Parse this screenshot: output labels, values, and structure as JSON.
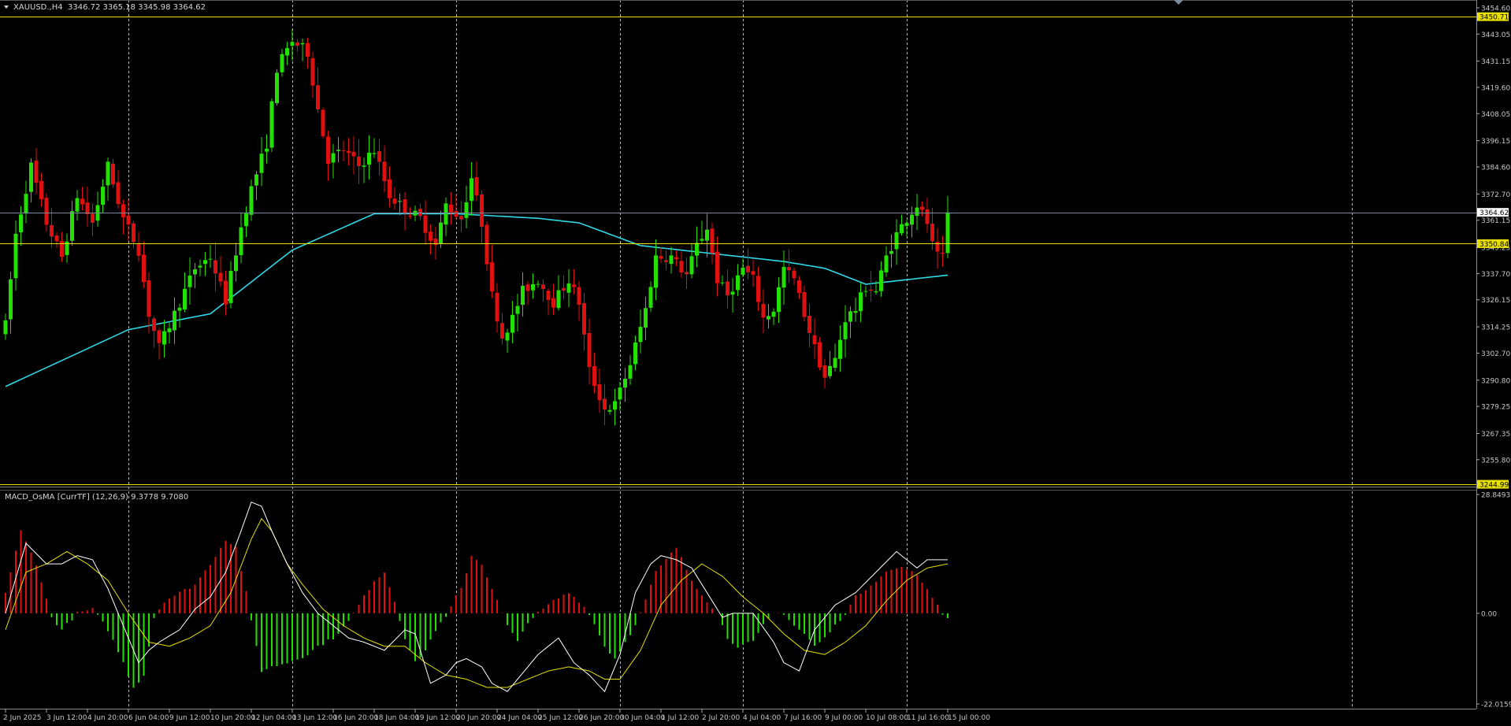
{
  "main_header": {
    "symbol": "XAUUSD.,H4",
    "open": "3346.72",
    "high": "3365.18",
    "low": "3345.98",
    "close": "3364.62"
  },
  "sub_header": {
    "indicator": "MACD_OsMA [CurrTF] (12,26,9)",
    "value1": "9.3778",
    "value2": "9.7080"
  },
  "colors": {
    "background": "#000000",
    "bull": "#22e000",
    "bear": "#e01010",
    "ma": "#30d8e8",
    "hline": "#e8e000",
    "macd_main": "#ffffff",
    "macd_signal": "#e8e000",
    "axis_text": "#c8c8c8"
  },
  "price_axis": {
    "ylim": [
      3245.0,
      3457.0
    ],
    "tick_labels": [
      "3454.60",
      "3443.05",
      "3431.15",
      "3419.60",
      "3408.05",
      "3396.15",
      "3384.60",
      "3372.70",
      "3361.15",
      "3349.25",
      "3337.70",
      "3326.15",
      "3314.25",
      "3302.70",
      "3290.80",
      "3279.25",
      "3267.35",
      "3255.80"
    ],
    "tick_values": [
      3454.6,
      3443.05,
      3431.15,
      3419.6,
      3408.05,
      3396.15,
      3384.6,
      3372.7,
      3361.15,
      3349.25,
      3337.7,
      3326.15,
      3314.25,
      3302.7,
      3290.8,
      3279.25,
      3267.35,
      3255.8
    ],
    "current_price": "3364.62",
    "hlines": [
      {
        "label": "3450.71",
        "value": 3450.71
      },
      {
        "label": "3350.84",
        "value": 3350.84
      },
      {
        "label": "3244.99",
        "value": 3244.99
      }
    ]
  },
  "macd_axis": {
    "ylim": [
      -22.0159,
      28.8493
    ],
    "tick_labels": [
      "28.8493",
      "0.00",
      "-22.0159"
    ],
    "tick_values": [
      28.8493,
      0.0,
      -22.0159
    ]
  },
  "time_axis": {
    "labels": [
      "2 Jun 2025",
      "3 Jun 12:00",
      "4 Jun 20:00",
      "6 Jun 04:00",
      "9 Jun 12:00",
      "10 Jun 20:00",
      "12 Jun 04:00",
      "13 Jun 12:00",
      "16 Jun 20:00",
      "18 Jun 04:00",
      "19 Jun 12:00",
      "20 Jun 20:00",
      "24 Jun 04:00",
      "25 Jun 12:00",
      "26 Jun 20:00",
      "30 Jun 04:00",
      "1 Jul 12:00",
      "2 Jul 20:00",
      "4 Jul 04:00",
      "7 Jul 16:00",
      "9 Jul 00:00",
      "10 Jul 08:00",
      "11 Jul 16:00",
      "15 Jul 00:00"
    ],
    "label_bar_index": [
      0,
      8,
      16,
      24,
      32,
      40,
      48,
      56,
      64,
      72,
      80,
      88,
      96,
      104,
      112,
      120,
      128,
      136,
      144,
      152,
      160,
      168,
      176,
      184
    ],
    "separator_labels": [
      "6 Jun 04:00",
      "13 Jun 12:00",
      "20 Jun 20:00",
      "30 Jun 04:00",
      "4 Jul 04:00",
      "11 Jul 16:00"
    ]
  },
  "chart_data": [
    {
      "type": "candlestick",
      "title": "XAUUSD.,H4",
      "anchors": [
        [
          0,
          3315
        ],
        [
          2,
          3355
        ],
        [
          5,
          3385
        ],
        [
          8,
          3360
        ],
        [
          11,
          3345
        ],
        [
          14,
          3372
        ],
        [
          17,
          3360
        ],
        [
          20,
          3385
        ],
        [
          23,
          3362
        ],
        [
          26,
          3348
        ],
        [
          28,
          3320
        ],
        [
          30,
          3305
        ],
        [
          34,
          3325
        ],
        [
          37,
          3340
        ],
        [
          40,
          3345
        ],
        [
          43,
          3326
        ],
        [
          46,
          3358
        ],
        [
          48,
          3375
        ],
        [
          51,
          3395
        ],
        [
          53,
          3428
        ],
        [
          56,
          3440
        ],
        [
          59,
          3435
        ],
        [
          61,
          3410
        ],
        [
          63,
          3388
        ],
        [
          66,
          3392
        ],
        [
          69,
          3385
        ],
        [
          72,
          3392
        ],
        [
          75,
          3372
        ],
        [
          78,
          3366
        ],
        [
          81,
          3362
        ],
        [
          84,
          3350
        ],
        [
          86,
          3368
        ],
        [
          89,
          3362
        ],
        [
          91,
          3380
        ],
        [
          93,
          3360
        ],
        [
          95,
          3328
        ],
        [
          97,
          3310
        ],
        [
          99,
          3318
        ],
        [
          101,
          3330
        ],
        [
          104,
          3335
        ],
        [
          107,
          3325
        ],
        [
          110,
          3335
        ],
        [
          112,
          3325
        ],
        [
          114,
          3295
        ],
        [
          117,
          3278
        ],
        [
          119,
          3280
        ],
        [
          122,
          3298
        ],
        [
          125,
          3322
        ],
        [
          127,
          3345
        ],
        [
          130,
          3345
        ],
        [
          133,
          3337
        ],
        [
          135,
          3350
        ],
        [
          137,
          3358
        ],
        [
          139,
          3335
        ],
        [
          141,
          3328
        ],
        [
          144,
          3340
        ],
        [
          146,
          3335
        ],
        [
          148,
          3318
        ],
        [
          150,
          3322
        ],
        [
          152,
          3340
        ],
        [
          154,
          3335
        ],
        [
          156,
          3320
        ],
        [
          158,
          3305
        ],
        [
          160,
          3292
        ],
        [
          162,
          3300
        ],
        [
          164,
          3318
        ],
        [
          166,
          3322
        ],
        [
          168,
          3332
        ],
        [
          170,
          3330
        ],
        [
          172,
          3345
        ],
        [
          174,
          3355
        ],
        [
          176,
          3362
        ],
        [
          178,
          3368
        ],
        [
          180,
          3360
        ],
        [
          181,
          3350
        ],
        [
          182,
          3345
        ],
        [
          183,
          3346.72
        ],
        [
          184,
          3364.62
        ]
      ],
      "ma_anchors": [
        [
          0,
          3288
        ],
        [
          24,
          3313
        ],
        [
          40,
          3320
        ],
        [
          56,
          3348
        ],
        [
          72,
          3364
        ],
        [
          88,
          3364
        ],
        [
          104,
          3362
        ],
        [
          112,
          3360
        ],
        [
          124,
          3350
        ],
        [
          140,
          3346
        ],
        [
          152,
          3343
        ],
        [
          160,
          3340
        ],
        [
          168,
          3333
        ],
        [
          176,
          3335
        ],
        [
          184,
          3337
        ]
      ]
    },
    {
      "type": "histogram",
      "title": "MACD_OsMA [CurrTF] (12,26,9)",
      "osma_anchors": [
        [
          0,
          5
        ],
        [
          3,
          20
        ],
        [
          6,
          12
        ],
        [
          9,
          -1
        ],
        [
          11,
          -4
        ],
        [
          14,
          0
        ],
        [
          17,
          1
        ],
        [
          20,
          -4
        ],
        [
          23,
          -12
        ],
        [
          25,
          -18
        ],
        [
          27,
          -15
        ],
        [
          29,
          -1
        ],
        [
          31,
          3
        ],
        [
          34,
          5
        ],
        [
          37,
          7
        ],
        [
          40,
          12
        ],
        [
          43,
          18
        ],
        [
          45,
          16
        ],
        [
          47,
          5
        ],
        [
          48,
          -2
        ],
        [
          50,
          -14
        ],
        [
          52,
          -13
        ],
        [
          55,
          -12
        ],
        [
          59,
          -10
        ],
        [
          61,
          -8
        ],
        [
          64,
          -6
        ],
        [
          67,
          -2
        ],
        [
          69,
          2
        ],
        [
          72,
          8
        ],
        [
          74,
          10
        ],
        [
          76,
          3
        ],
        [
          78,
          -6
        ],
        [
          80,
          -12
        ],
        [
          82,
          -9
        ],
        [
          84,
          -4
        ],
        [
          86,
          -1
        ],
        [
          88,
          4
        ],
        [
          89,
          6
        ],
        [
          91,
          14
        ],
        [
          93,
          12
        ],
        [
          96,
          3
        ],
        [
          98,
          -3
        ],
        [
          100,
          -7
        ],
        [
          102,
          -2
        ],
        [
          104,
          0
        ],
        [
          107,
          3
        ],
        [
          110,
          5
        ],
        [
          112,
          3
        ],
        [
          114,
          0
        ],
        [
          117,
          -8
        ],
        [
          119,
          -11
        ],
        [
          122,
          -5
        ],
        [
          124,
          0
        ],
        [
          127,
          10
        ],
        [
          129,
          13
        ],
        [
          131,
          16
        ],
        [
          134,
          8
        ],
        [
          137,
          3
        ],
        [
          139,
          0
        ],
        [
          141,
          -6
        ],
        [
          143,
          -8
        ],
        [
          146,
          -7
        ],
        [
          148,
          -3
        ],
        [
          150,
          0
        ],
        [
          152,
          0
        ],
        [
          154,
          -3
        ],
        [
          156,
          -5
        ],
        [
          158,
          -8
        ],
        [
          160,
          -6
        ],
        [
          162,
          -3
        ],
        [
          164,
          0
        ],
        [
          166,
          4
        ],
        [
          168,
          6
        ],
        [
          170,
          8
        ],
        [
          172,
          10
        ],
        [
          174,
          11
        ],
        [
          176,
          11
        ],
        [
          178,
          9
        ],
        [
          180,
          6
        ],
        [
          182,
          2
        ],
        [
          183,
          0
        ],
        [
          184,
          -1
        ]
      ],
      "main_anchors": [
        [
          0,
          0
        ],
        [
          4,
          17
        ],
        [
          8,
          12
        ],
        [
          11,
          12
        ],
        [
          14,
          14
        ],
        [
          17,
          13
        ],
        [
          20,
          6
        ],
        [
          23,
          -3
        ],
        [
          26,
          -12
        ],
        [
          28,
          -9
        ],
        [
          30,
          -7
        ],
        [
          34,
          -4
        ],
        [
          37,
          1
        ],
        [
          40,
          4
        ],
        [
          43,
          10
        ],
        [
          46,
          20
        ],
        [
          48,
          27
        ],
        [
          50,
          26
        ],
        [
          52,
          20
        ],
        [
          55,
          12
        ],
        [
          58,
          5
        ],
        [
          61,
          0
        ],
        [
          64,
          -3
        ],
        [
          67,
          -6
        ],
        [
          70,
          -7
        ],
        [
          74,
          -9
        ],
        [
          78,
          -4
        ],
        [
          80,
          -5
        ],
        [
          83,
          -17
        ],
        [
          86,
          -15
        ],
        [
          88,
          -12
        ],
        [
          90,
          -11
        ],
        [
          93,
          -13
        ],
        [
          95,
          -17
        ],
        [
          98,
          -19
        ],
        [
          100,
          -16
        ],
        [
          104,
          -10
        ],
        [
          108,
          -6
        ],
        [
          111,
          -12
        ],
        [
          114,
          -15
        ],
        [
          117,
          -19
        ],
        [
          120,
          -10
        ],
        [
          123,
          5
        ],
        [
          126,
          12
        ],
        [
          128,
          14
        ],
        [
          131,
          13
        ],
        [
          134,
          11
        ],
        [
          137,
          5
        ],
        [
          140,
          -1
        ],
        [
          142,
          0
        ],
        [
          146,
          0
        ],
        [
          150,
          -7
        ],
        [
          152,
          -12
        ],
        [
          155,
          -14
        ],
        [
          158,
          -4
        ],
        [
          162,
          2
        ],
        [
          166,
          5
        ],
        [
          170,
          10
        ],
        [
          174,
          15
        ],
        [
          176,
          13
        ],
        [
          178,
          11
        ],
        [
          180,
          13
        ],
        [
          184,
          13
        ]
      ],
      "signal_anchors": [
        [
          0,
          -4
        ],
        [
          4,
          10
        ],
        [
          8,
          12
        ],
        [
          12,
          15
        ],
        [
          16,
          12
        ],
        [
          20,
          8
        ],
        [
          24,
          0
        ],
        [
          28,
          -7
        ],
        [
          32,
          -8
        ],
        [
          36,
          -6
        ],
        [
          40,
          -3
        ],
        [
          44,
          5
        ],
        [
          48,
          18
        ],
        [
          50,
          23
        ],
        [
          52,
          20
        ],
        [
          55,
          12
        ],
        [
          58,
          7
        ],
        [
          62,
          1
        ],
        [
          66,
          -3
        ],
        [
          70,
          -6
        ],
        [
          74,
          -8
        ],
        [
          78,
          -8
        ],
        [
          82,
          -12
        ],
        [
          86,
          -15
        ],
        [
          90,
          -16
        ],
        [
          94,
          -18
        ],
        [
          98,
          -18
        ],
        [
          102,
          -16
        ],
        [
          106,
          -14
        ],
        [
          110,
          -13
        ],
        [
          114,
          -14
        ],
        [
          117,
          -16
        ],
        [
          120,
          -16
        ],
        [
          124,
          -9
        ],
        [
          128,
          2
        ],
        [
          132,
          8
        ],
        [
          136,
          12
        ],
        [
          140,
          9
        ],
        [
          144,
          4
        ],
        [
          148,
          0
        ],
        [
          152,
          -5
        ],
        [
          156,
          -9
        ],
        [
          160,
          -10
        ],
        [
          164,
          -7
        ],
        [
          168,
          -3
        ],
        [
          172,
          3
        ],
        [
          176,
          8
        ],
        [
          180,
          11
        ],
        [
          184,
          12
        ]
      ]
    }
  ]
}
